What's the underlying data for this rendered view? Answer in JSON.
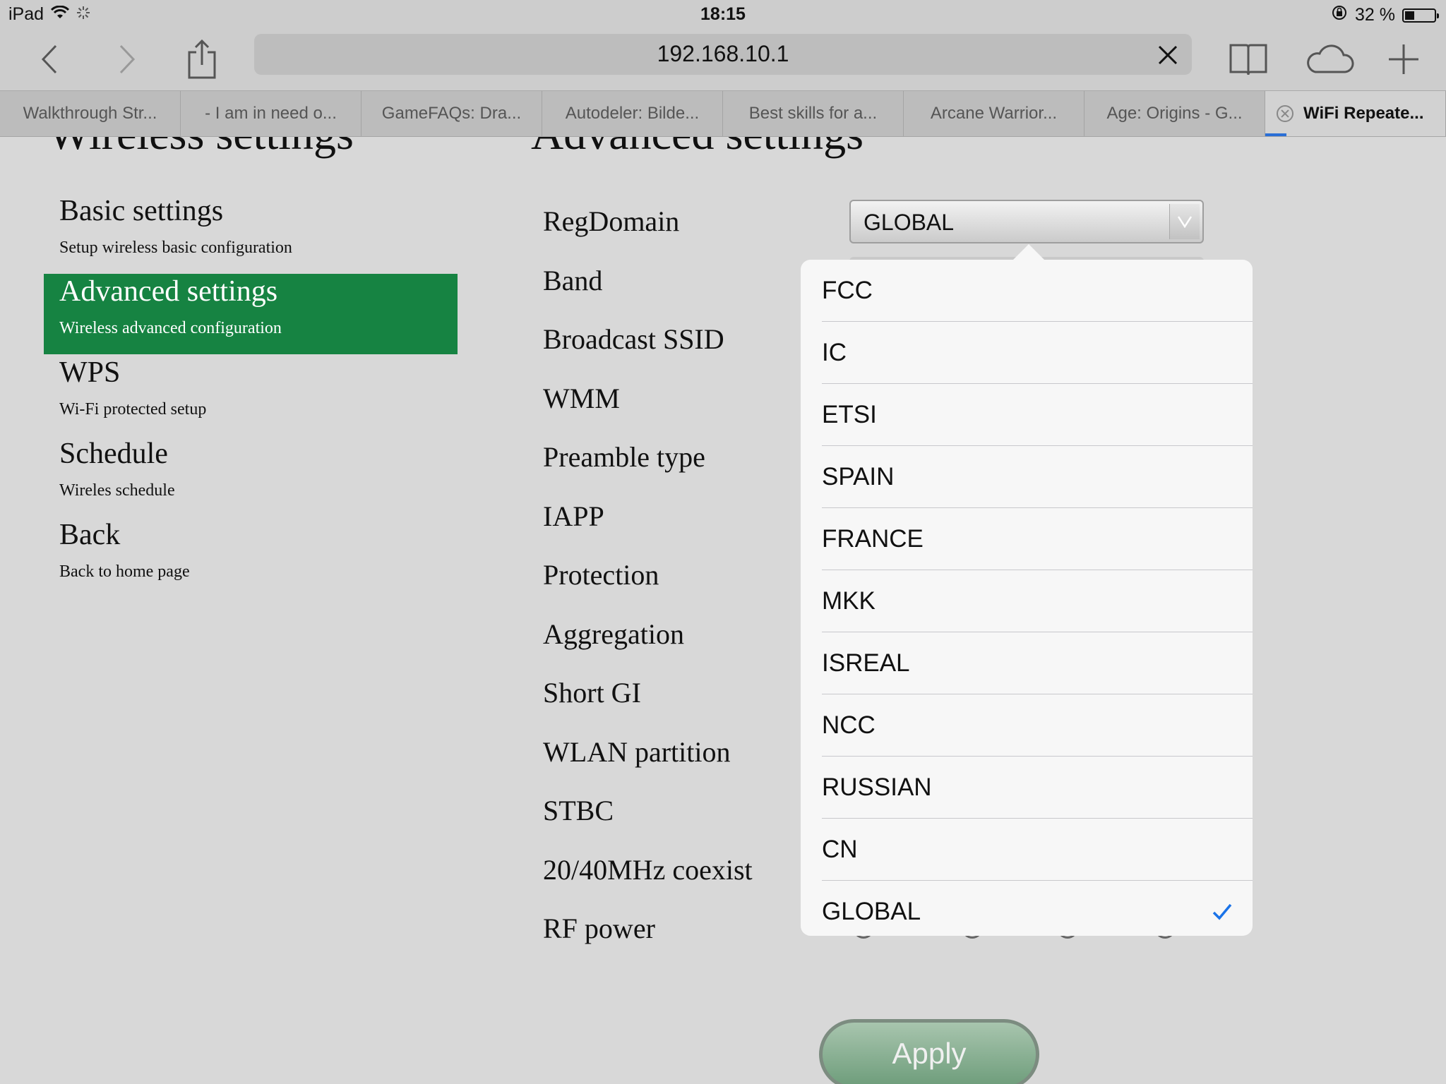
{
  "status_bar": {
    "device": "iPad",
    "time": "18:15",
    "battery": "32 %",
    "battery_level": 0.32
  },
  "browser": {
    "url": "192.168.10.1",
    "tabs": [
      {
        "label": "Walkthrough Str..."
      },
      {
        "label": "- I am in need o..."
      },
      {
        "label": "GameFAQs: Dra..."
      },
      {
        "label": "Autodeler: Bilde..."
      },
      {
        "label": "Best skills for a..."
      },
      {
        "label": "Arcane Warrior..."
      },
      {
        "label": "Age: Origins - G..."
      },
      {
        "label": "WiFi Repeate..."
      }
    ]
  },
  "page": {
    "left_heading": "Wireless settings",
    "right_heading": "Advanced settings",
    "menu": [
      {
        "title": "Basic settings",
        "desc": "Setup wireless basic configuration"
      },
      {
        "title": "Advanced settings",
        "desc": "Wireless advanced configuration"
      },
      {
        "title": "WPS",
        "desc": "Wi-Fi protected setup"
      },
      {
        "title": "Schedule",
        "desc": "Wireles schedule"
      },
      {
        "title": "Back",
        "desc": "Back to home page"
      }
    ],
    "fields": [
      "RegDomain",
      "Band",
      "Broadcast SSID",
      "WMM",
      "Preamble type",
      "IAPP",
      "Protection",
      "Aggregation",
      "Short GI",
      "WLAN partition",
      "STBC",
      "20/40MHz coexist",
      "RF power"
    ],
    "regdomain_value": "GLOBAL",
    "apply_label": "Apply"
  },
  "dropdown": {
    "options": [
      "FCC",
      "IC",
      "ETSI",
      "SPAIN",
      "FRANCE",
      "MKK",
      "ISREAL",
      "NCC",
      "RUSSIAN",
      "CN",
      "GLOBAL"
    ],
    "selected": "GLOBAL"
  },
  "colors": {
    "active_menu": "#168342",
    "check": "#1a73e8",
    "tab_indicator": "#2a6fd6"
  }
}
